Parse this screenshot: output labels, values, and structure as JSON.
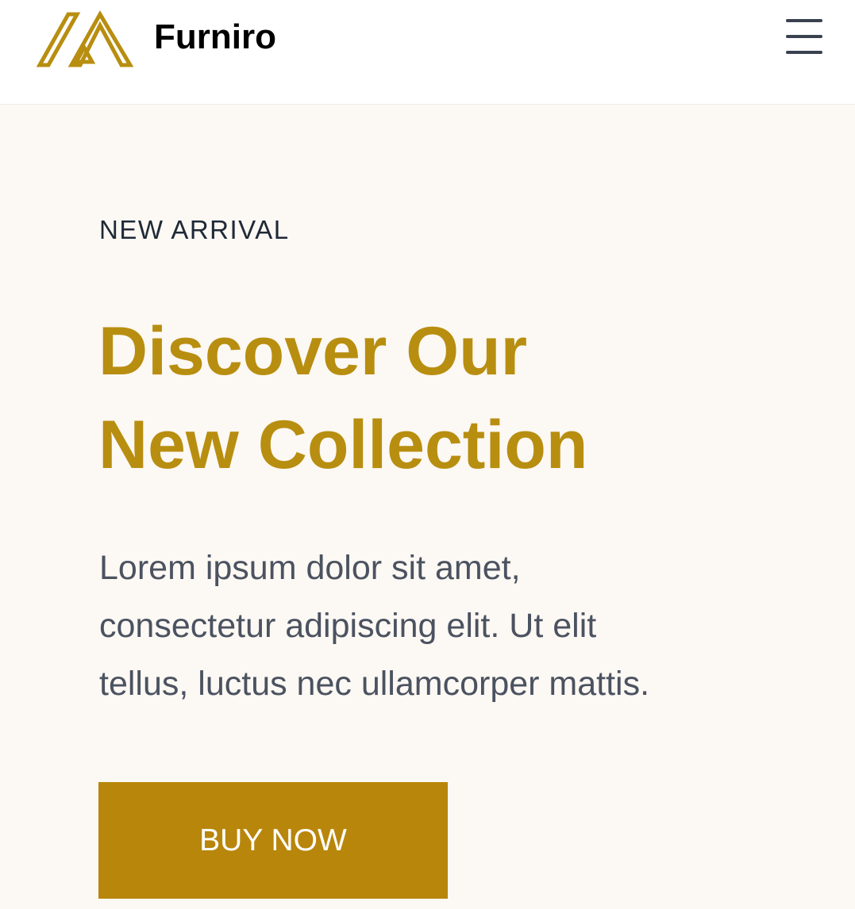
{
  "header": {
    "brand": "Furniro",
    "logo_icon": "furniro-logo-icon",
    "menu_icon": "hamburger-menu-icon"
  },
  "hero": {
    "eyebrow": "NEW ARRIVAL",
    "title_lines": [
      "Discover Our",
      "New Collection"
    ],
    "description_lines": [
      "Lorem ipsum dolor sit amet,",
      "consectetur adipiscing elit. Ut elit",
      "tellus, luctus nec ullamcorper mattis."
    ],
    "cta_label": "BUY NOW"
  },
  "colors": {
    "accent": "#B88E10",
    "button": "#B8860B",
    "hero_background": "#FCF8F3",
    "header_background": "#FFFFFF"
  }
}
